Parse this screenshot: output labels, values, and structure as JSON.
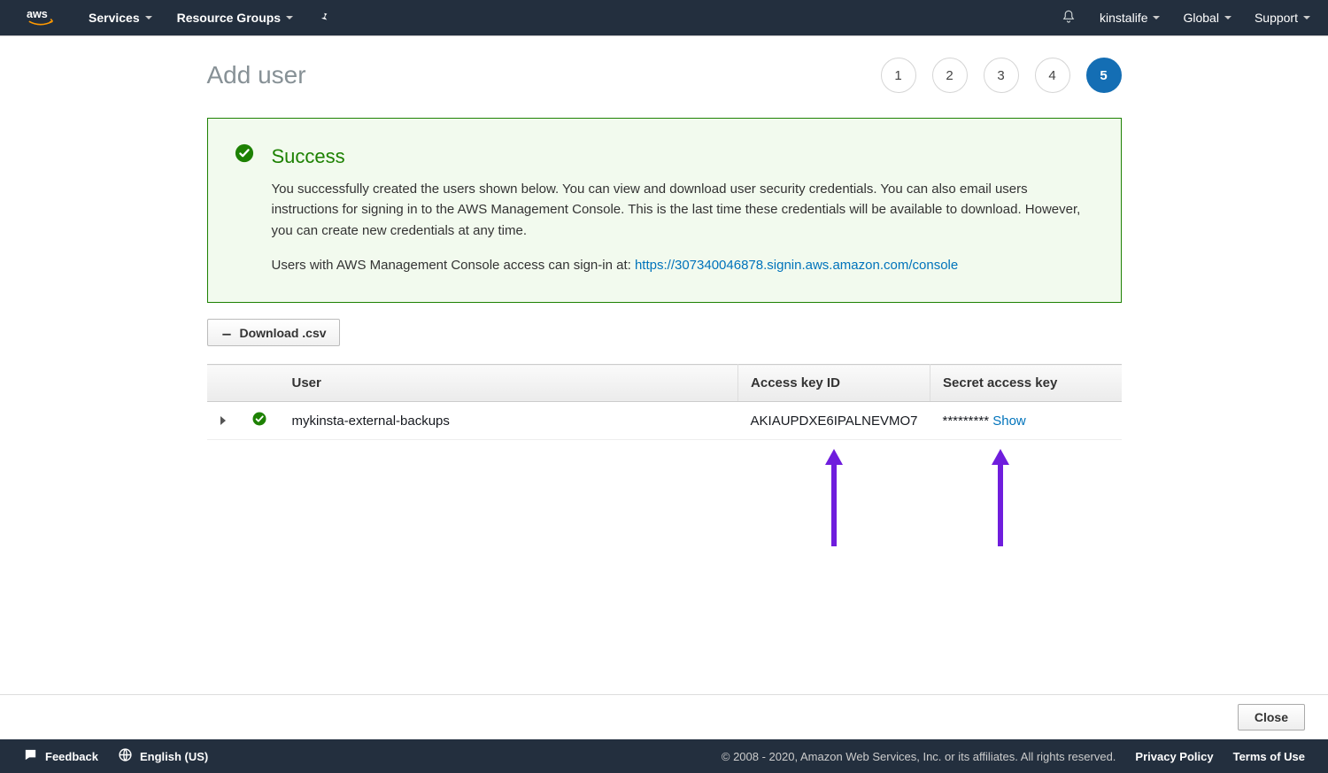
{
  "nav": {
    "services": "Services",
    "resource_groups": "Resource Groups",
    "account": "kinstalife",
    "region": "Global",
    "support": "Support"
  },
  "page": {
    "title": "Add user",
    "steps": [
      "1",
      "2",
      "3",
      "4",
      "5"
    ],
    "active_step": 4
  },
  "alert": {
    "title": "Success",
    "body1": "You successfully created the users shown below. You can view and download user security credentials. You can also email users instructions for signing in to the AWS Management Console. This is the last time these credentials will be available to download. However, you can create new credentials at any time.",
    "body2_prefix": "Users with AWS Management Console access can sign-in at: ",
    "signin_url": "https://307340046878.signin.aws.amazon.com/console"
  },
  "buttons": {
    "download_csv": "Download .csv",
    "close": "Close"
  },
  "table": {
    "headers": {
      "user": "User",
      "access_key_id": "Access key ID",
      "secret_access_key": "Secret access key"
    },
    "row": {
      "user": "mykinsta-external-backups",
      "access_key_id": "AKIAUPDXE6IPALNEVMO7",
      "secret_masked": "*********",
      "show": "Show"
    }
  },
  "footer": {
    "feedback": "Feedback",
    "language": "English (US)",
    "copyright": "© 2008 - 2020, Amazon Web Services, Inc. or its affiliates. All rights reserved.",
    "privacy": "Privacy Policy",
    "terms": "Terms of Use"
  }
}
